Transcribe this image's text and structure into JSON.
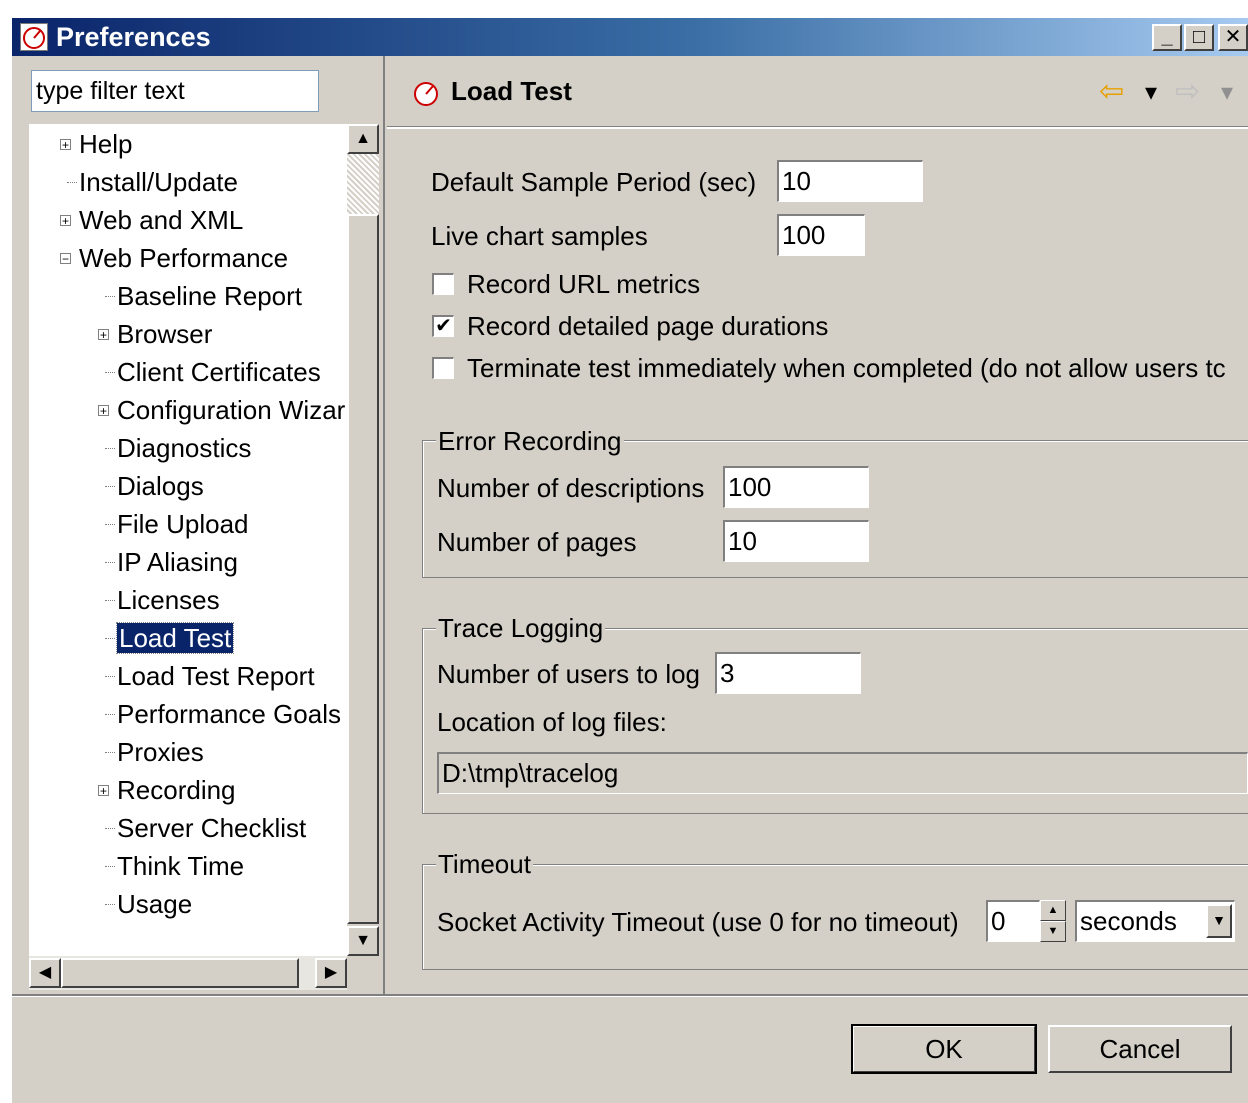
{
  "window": {
    "title": "Preferences",
    "controls": {
      "minimize": "_",
      "maximize": "□",
      "close": "✕"
    }
  },
  "left": {
    "filter_placeholder": "type filter text",
    "tree": [
      {
        "label": "Help",
        "expander": "+"
      },
      {
        "label": "Install/Update",
        "expander": ""
      },
      {
        "label": "Web and XML",
        "expander": "+"
      },
      {
        "label": "Web Performance",
        "expander": "−"
      },
      {
        "label": "Baseline Report",
        "expander": ""
      },
      {
        "label": "Browser",
        "expander": "+"
      },
      {
        "label": "Client Certificates",
        "expander": ""
      },
      {
        "label": "Configuration Wizar",
        "expander": "+"
      },
      {
        "label": "Diagnostics",
        "expander": ""
      },
      {
        "label": "Dialogs",
        "expander": ""
      },
      {
        "label": "File Upload",
        "expander": ""
      },
      {
        "label": "IP Aliasing",
        "expander": ""
      },
      {
        "label": "Licenses",
        "expander": ""
      },
      {
        "label": "Load Test",
        "expander": "",
        "selected": true
      },
      {
        "label": "Load Test Report",
        "expander": ""
      },
      {
        "label": "Performance Goals",
        "expander": ""
      },
      {
        "label": "Proxies",
        "expander": ""
      },
      {
        "label": "Recording",
        "expander": "+"
      },
      {
        "label": "Server Checklist",
        "expander": ""
      },
      {
        "label": "Think Time",
        "expander": ""
      },
      {
        "label": "Usage",
        "expander": ""
      }
    ],
    "scroll": {
      "up": "▲",
      "down": "▼",
      "left": "◀",
      "right": "▶"
    }
  },
  "page": {
    "title": "Load Test",
    "nav": {
      "back": "⇦",
      "back_menu": "▾",
      "forward": "⇨",
      "forward_menu": "▾"
    },
    "default_sample_period": {
      "label": "Default Sample Period (sec)",
      "value": "10"
    },
    "live_chart_samples": {
      "label": "Live chart samples",
      "value": "100"
    },
    "record_url_metrics": {
      "label": "Record URL metrics",
      "checked": false,
      "mark": ""
    },
    "record_detailed_page_durations": {
      "label": "Record detailed page durations",
      "checked": true,
      "mark": "✔"
    },
    "terminate_test": {
      "label": "Terminate test immediately when completed (do not allow users tc",
      "checked": false,
      "mark": ""
    },
    "error_recording": {
      "title": "Error Recording",
      "descriptions": {
        "label": "Number of descriptions",
        "value": "100"
      },
      "pages": {
        "label": "Number of pages",
        "value": "10"
      }
    },
    "trace_logging": {
      "title": "Trace Logging",
      "users": {
        "label": "Number of users to log",
        "value": "3"
      },
      "location_label": "Location of log files:",
      "location_value": "D:\\tmp\\tracelog"
    },
    "timeout": {
      "title": "Timeout",
      "label": "Socket Activity Timeout (use 0 for no timeout)",
      "value": "0",
      "unit": "seconds"
    }
  },
  "buttons": {
    "ok": "OK",
    "cancel": "Cancel"
  }
}
